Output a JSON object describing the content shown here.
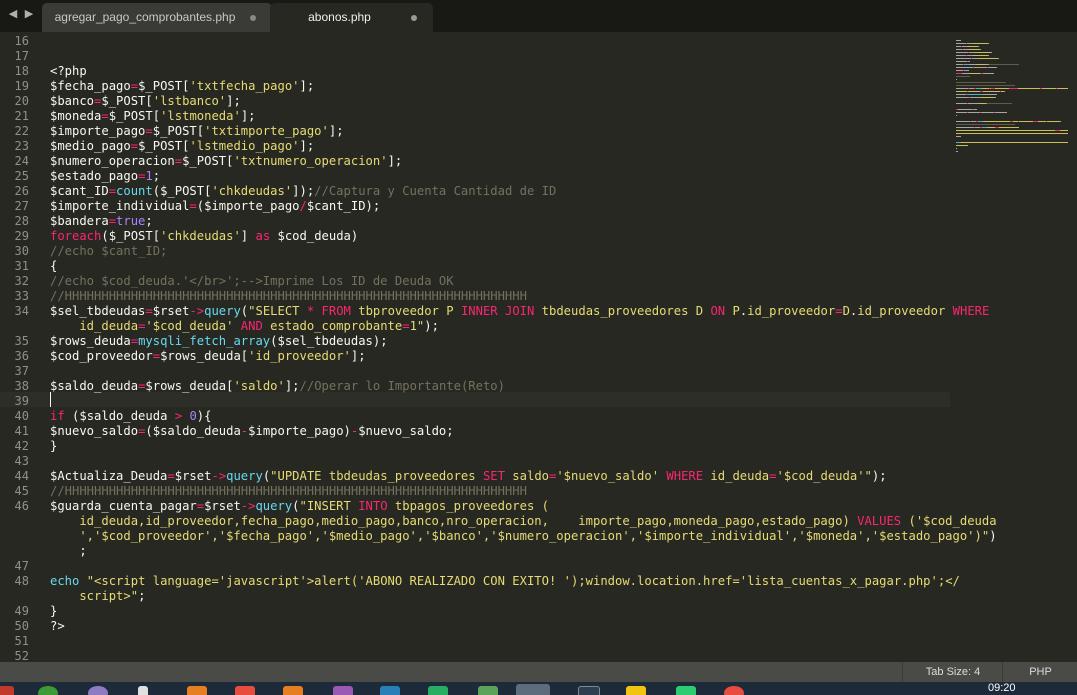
{
  "tabs": [
    {
      "label": "agregar_pago_comprobantes.php",
      "active": false
    },
    {
      "label": "abonos.php",
      "active": true
    }
  ],
  "nav": {
    "back": "◀",
    "forward": "▶"
  },
  "editor": {
    "lines": [
      {
        "n": "16",
        "tokens": []
      },
      {
        "n": "17",
        "tokens": []
      },
      {
        "n": "18",
        "tokens": [
          [
            "w",
            "<?php"
          ]
        ]
      },
      {
        "n": "19",
        "tokens": [
          [
            "w",
            "$fecha_pago"
          ],
          [
            "p",
            "="
          ],
          [
            "w",
            "$_POST["
          ],
          [
            "s",
            "'txtfecha_pago'"
          ],
          [
            "w",
            "];"
          ]
        ]
      },
      {
        "n": "20",
        "tokens": [
          [
            "w",
            "$banco"
          ],
          [
            "p",
            "="
          ],
          [
            "w",
            "$_POST["
          ],
          [
            "s",
            "'lstbanco'"
          ],
          [
            "w",
            "];"
          ]
        ]
      },
      {
        "n": "21",
        "tokens": [
          [
            "w",
            "$moneda"
          ],
          [
            "p",
            "="
          ],
          [
            "w",
            "$_POST["
          ],
          [
            "s",
            "'lstmoneda'"
          ],
          [
            "w",
            "];"
          ]
        ]
      },
      {
        "n": "22",
        "tokens": [
          [
            "w",
            "$importe_pago"
          ],
          [
            "p",
            "="
          ],
          [
            "w",
            "$_POST["
          ],
          [
            "s",
            "'txtimporte_pago'"
          ],
          [
            "w",
            "];"
          ]
        ]
      },
      {
        "n": "23",
        "tokens": [
          [
            "w",
            "$medio_pago"
          ],
          [
            "p",
            "="
          ],
          [
            "w",
            "$_POST["
          ],
          [
            "s",
            "'lstmedio_pago'"
          ],
          [
            "w",
            "];"
          ]
        ]
      },
      {
        "n": "24",
        "tokens": [
          [
            "w",
            "$numero_operacion"
          ],
          [
            "p",
            "="
          ],
          [
            "w",
            "$_POST["
          ],
          [
            "s",
            "'txtnumero_operacion'"
          ],
          [
            "w",
            "];"
          ]
        ]
      },
      {
        "n": "25",
        "tokens": [
          [
            "w",
            "$estado_pago"
          ],
          [
            "p",
            "="
          ],
          [
            "n",
            "1"
          ],
          [
            "w",
            ";"
          ]
        ]
      },
      {
        "n": "26",
        "tokens": [
          [
            "w",
            "$cant_ID"
          ],
          [
            "p",
            "="
          ],
          [
            "f",
            "count"
          ],
          [
            "w",
            "($_POST["
          ],
          [
            "s",
            "'chkdeudas'"
          ],
          [
            "w",
            "]);"
          ],
          [
            "c",
            "//Captura y Cuenta Cantidad de ID"
          ]
        ]
      },
      {
        "n": "27",
        "tokens": [
          [
            "w",
            "$importe_individual"
          ],
          [
            "p",
            "="
          ],
          [
            "w",
            "($importe_pago"
          ],
          [
            "p",
            "/"
          ],
          [
            "w",
            "$cant_ID);"
          ]
        ]
      },
      {
        "n": "28",
        "tokens": [
          [
            "w",
            "$bandera"
          ],
          [
            "p",
            "="
          ],
          [
            "n",
            "true"
          ],
          [
            "w",
            ";"
          ]
        ]
      },
      {
        "n": "29",
        "tokens": [
          [
            "p",
            "foreach"
          ],
          [
            "w",
            "($_POST["
          ],
          [
            "s",
            "'chkdeudas'"
          ],
          [
            "w",
            "] "
          ],
          [
            "p",
            "as"
          ],
          [
            "w",
            " $cod_deuda)"
          ]
        ]
      },
      {
        "n": "30",
        "tokens": [
          [
            "c",
            "//echo $cant_ID;"
          ]
        ]
      },
      {
        "n": "31",
        "tokens": [
          [
            "w",
            "{"
          ]
        ]
      },
      {
        "n": "32",
        "tokens": [
          [
            "c",
            "//echo $cod_deuda.'</br>';-->Imprime Los ID de Deuda OK"
          ]
        ]
      },
      {
        "n": "33",
        "tokens": [
          [
            "c",
            "//HHHHHHHHHHHHHHHHHHHHHHHHHHHHHHHHHHHHHHHHHHHHHHHHHHHHHHHHHHHHHHH"
          ]
        ]
      },
      {
        "n": "34",
        "tokens": [
          [
            "w",
            "$sel_tbdeudas"
          ],
          [
            "p",
            "="
          ],
          [
            "w",
            "$rset"
          ],
          [
            "p",
            "->"
          ],
          [
            "f",
            "query"
          ],
          [
            "w",
            "("
          ],
          [
            "s",
            "\"SELECT "
          ],
          [
            "p",
            "*"
          ],
          [
            "s",
            " "
          ],
          [
            "p",
            "FROM"
          ],
          [
            "s",
            " tbproveedor P "
          ],
          [
            "p",
            "INNER JOIN"
          ],
          [
            "s",
            " tbdeudas_proveedores D "
          ],
          [
            "p",
            "ON"
          ],
          [
            "s",
            " P"
          ],
          [
            "w",
            "."
          ],
          [
            "s",
            "id_proveedor"
          ],
          [
            "p",
            "="
          ],
          [
            "s",
            "D"
          ],
          [
            "w",
            "."
          ],
          [
            "s",
            "id_proveedor "
          ],
          [
            "p",
            "WHERE"
          ]
        ]
      },
      {
        "n": "",
        "tokens": [
          [
            "s",
            "    id_deuda"
          ],
          [
            "p",
            "="
          ],
          [
            "s",
            "'$cod_deuda' "
          ],
          [
            "p",
            "AND"
          ],
          [
            "s",
            " estado_comprobante"
          ],
          [
            "p",
            "="
          ],
          [
            "s",
            "1\""
          ],
          [
            "w",
            ");"
          ]
        ]
      },
      {
        "n": "35",
        "tokens": [
          [
            "w",
            "$rows_deuda"
          ],
          [
            "p",
            "="
          ],
          [
            "f",
            "mysqli_fetch_array"
          ],
          [
            "w",
            "($sel_tbdeudas);"
          ]
        ]
      },
      {
        "n": "36",
        "tokens": [
          [
            "w",
            "$cod_proveedor"
          ],
          [
            "p",
            "="
          ],
          [
            "w",
            "$rows_deuda["
          ],
          [
            "s",
            "'id_proveedor'"
          ],
          [
            "w",
            "];"
          ]
        ]
      },
      {
        "n": "37",
        "tokens": []
      },
      {
        "n": "38",
        "tokens": [
          [
            "w",
            "$saldo_deuda"
          ],
          [
            "p",
            "="
          ],
          [
            "w",
            "$rows_deuda["
          ],
          [
            "s",
            "'saldo'"
          ],
          [
            "w",
            "];"
          ],
          [
            "c",
            "//Operar lo Importante(Reto)"
          ]
        ]
      },
      {
        "n": "39",
        "tokens": []
      },
      {
        "n": "40",
        "tokens": [
          [
            "p",
            "if"
          ],
          [
            "w",
            " ($saldo_deuda "
          ],
          [
            "p",
            ">"
          ],
          [
            "w",
            " "
          ],
          [
            "n",
            "0"
          ],
          [
            "w",
            "){"
          ]
        ]
      },
      {
        "n": "41",
        "tokens": [
          [
            "w",
            "$nuevo_saldo"
          ],
          [
            "p",
            "="
          ],
          [
            "w",
            "($saldo_deuda"
          ],
          [
            "p",
            "-"
          ],
          [
            "w",
            "$importe_pago)"
          ],
          [
            "p",
            "-"
          ],
          [
            "w",
            "$nuevo_saldo;"
          ]
        ]
      },
      {
        "n": "42",
        "tokens": [
          [
            "w",
            "}"
          ]
        ]
      },
      {
        "n": "43",
        "tokens": []
      },
      {
        "n": "44",
        "tokens": [
          [
            "w",
            "$Actualiza_Deuda"
          ],
          [
            "p",
            "="
          ],
          [
            "w",
            "$rset"
          ],
          [
            "p",
            "->"
          ],
          [
            "f",
            "query"
          ],
          [
            "w",
            "("
          ],
          [
            "s",
            "\"UPDATE tbdeudas_proveedores "
          ],
          [
            "p",
            "SET"
          ],
          [
            "s",
            " saldo"
          ],
          [
            "p",
            "="
          ],
          [
            "s",
            "'$nuevo_saldo' "
          ],
          [
            "p",
            "WHERE"
          ],
          [
            "s",
            " id_deuda"
          ],
          [
            "p",
            "="
          ],
          [
            "s",
            "'$cod_deuda'\""
          ],
          [
            "w",
            ");"
          ]
        ]
      },
      {
        "n": "45",
        "tokens": [
          [
            "c",
            "//HHHHHHHHHHHHHHHHHHHHHHHHHHHHHHHHHHHHHHHHHHHHHHHHHHHHHHHHHHHHHHH"
          ]
        ]
      },
      {
        "n": "46",
        "tokens": [
          [
            "w",
            "$guarda_cuenta_pagar"
          ],
          [
            "p",
            "="
          ],
          [
            "w",
            "$rset"
          ],
          [
            "p",
            "->"
          ],
          [
            "f",
            "query"
          ],
          [
            "w",
            "("
          ],
          [
            "s",
            "\"INSERT "
          ],
          [
            "p",
            "INTO"
          ],
          [
            "s",
            " tbpagos_proveedores ("
          ]
        ]
      },
      {
        "n": "",
        "tokens": [
          [
            "s",
            "    id_deuda,id_proveedor,fecha_pago,medio_pago,banco,nro_operacion,    importe_pago,moneda_pago,estado_pago) "
          ],
          [
            "p",
            "VALUES"
          ],
          [
            "s",
            " ('$cod_deuda"
          ]
        ]
      },
      {
        "n": "",
        "tokens": [
          [
            "s",
            "    ','$cod_proveedor','$fecha_pago','$medio_pago','$banco','$numero_operacion','$importe_individual','$moneda','$estado_pago')\""
          ],
          [
            "w",
            ")"
          ]
        ]
      },
      {
        "n": "",
        "tokens": [
          [
            "w",
            "    ;"
          ]
        ]
      },
      {
        "n": "47",
        "tokens": []
      },
      {
        "n": "48",
        "tokens": [
          [
            "f",
            "echo"
          ],
          [
            "w",
            " "
          ],
          [
            "s",
            "\"<script language='javascript'>alert('ABONO REALIZADO CON EXITO! ');window.location.href='lista_cuentas_x_pagar.php';</"
          ]
        ]
      },
      {
        "n": "",
        "tokens": [
          [
            "s",
            "    script>\""
          ],
          [
            "w",
            ";"
          ]
        ]
      },
      {
        "n": "49",
        "tokens": [
          [
            "w",
            "}"
          ]
        ]
      },
      {
        "n": "50",
        "tokens": [
          [
            "w",
            "?>"
          ]
        ]
      },
      {
        "n": "51",
        "tokens": []
      },
      {
        "n": "52",
        "tokens": []
      }
    ]
  },
  "statusbar": {
    "tab_size": "Tab Size: 4",
    "syntax": "PHP"
  },
  "taskbar": {
    "time": "09:20"
  },
  "colors": {
    "background": "#272822",
    "keyword": "#f92672",
    "string": "#e6db74",
    "number": "#ae81ff",
    "comment": "#75715e",
    "function": "#66d9ef",
    "text": "#f8f8f2"
  }
}
